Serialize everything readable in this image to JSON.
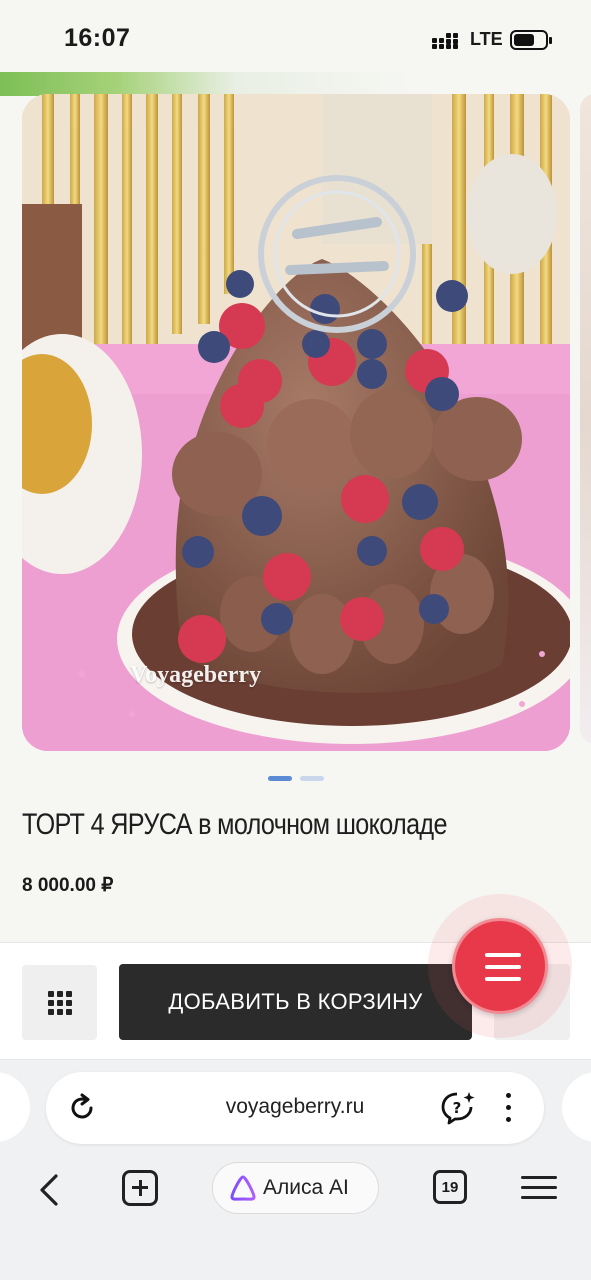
{
  "status_bar": {
    "time": "16:07",
    "network": "LTE"
  },
  "product": {
    "image_watermark": "Voyageberry",
    "title": "ТОРТ 4 ЯРУСА в молочном шоколаде",
    "price": "8 000.00 ₽",
    "carousel": {
      "total": 2,
      "active": 1
    }
  },
  "actions": {
    "add_to_cart_label": "ДОБАВИТЬ В КОРЗИНУ"
  },
  "browser": {
    "url": "voyageberry.ru",
    "assistant_label": "Алиса AI",
    "tab_count": "19"
  },
  "colors": {
    "accent_fab": "#e8394a",
    "cart_button": "#2b2b2b",
    "carousel_active": "#5b8bd4"
  },
  "icons": [
    "signal-icon",
    "battery-icon",
    "grid-icon",
    "menu-icon",
    "reload-icon",
    "assistant-icon",
    "more-icon",
    "back-icon",
    "new-tab-icon",
    "alice-icon",
    "tabs-icon",
    "hamburger-icon"
  ]
}
